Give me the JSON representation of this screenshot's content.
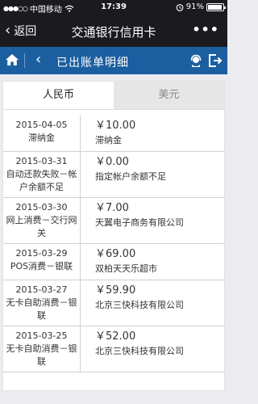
{
  "status_bar": {
    "carrier": "中国移动",
    "time": "17:39",
    "battery": "91%"
  },
  "nav": {
    "back_label": "返回",
    "title": "交通银行信用卡",
    "more": "•••"
  },
  "header": {
    "title": "已出账单明细"
  },
  "tabs": [
    {
      "label": "人民币",
      "active": true
    },
    {
      "label": "美元",
      "active": false
    }
  ],
  "transactions": [
    {
      "date": "2015-04-05",
      "type": "滞纳金",
      "amount": "￥10.00",
      "desc": "滞纳金"
    },
    {
      "date": "2015-03-31",
      "type": "自动还款失败－帐户余额不足",
      "amount": "￥0.00",
      "desc": "指定帐户余额不足"
    },
    {
      "date": "2015-03-30",
      "type": "网上消费－交行网关",
      "amount": "￥7.00",
      "desc": "天翼电子商务有限公司"
    },
    {
      "date": "2015-03-29",
      "type": "POS消费－银联",
      "amount": "￥69.00",
      "desc": "双柏天天乐超市"
    },
    {
      "date": "2015-03-27",
      "type": "无卡自助消费－银联",
      "amount": "￥59.90",
      "desc": "北京三快科技有限公司"
    },
    {
      "date": "2015-03-25",
      "type": "无卡自助消费－银联",
      "amount": "￥52.00",
      "desc": "北京三快科技有限公司"
    }
  ]
}
